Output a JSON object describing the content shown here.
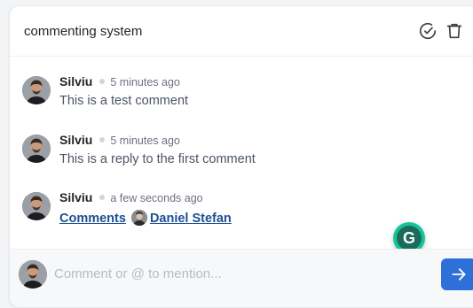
{
  "thread": {
    "title": "commenting system",
    "resolve_icon": "check-circle-icon",
    "delete_icon": "trash-icon"
  },
  "comments": [
    {
      "author": "Silviu",
      "time": "5 minutes ago",
      "text": "This is a test comment"
    },
    {
      "author": "Silviu",
      "time": "5 minutes ago",
      "text": "This is a reply to the first comment"
    },
    {
      "author": "Silviu",
      "time": "a few seconds ago",
      "mentions": [
        "Comments",
        "Daniel Stefan"
      ]
    }
  ],
  "grammarly": {
    "letter": "G"
  },
  "composer": {
    "placeholder": "Comment or @ to mention...",
    "send_icon": "arrow-right-icon"
  },
  "colors": {
    "accent": "#2e6fd8",
    "mention": "#1d4f91",
    "grammarly": "#15c39a"
  }
}
